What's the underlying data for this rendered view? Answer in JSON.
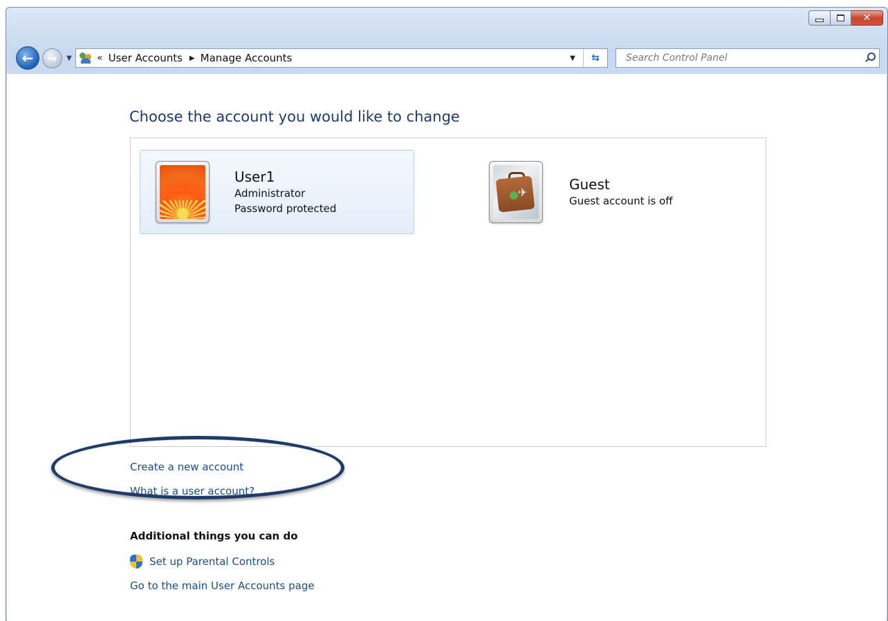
{
  "navigation": {
    "breadcrumb_overflow": "«",
    "breadcrumbs": [
      "User Accounts",
      "Manage Accounts"
    ]
  },
  "search": {
    "placeholder": "Search Control Panel"
  },
  "main": {
    "title": "Choose the account you would like to change",
    "accounts": [
      {
        "name": "User1",
        "lines": [
          "Administrator",
          "Password protected"
        ],
        "picture": "orange-flower",
        "selected": true
      },
      {
        "name": "Guest",
        "lines": [
          "Guest account is off"
        ],
        "picture": "suitcase",
        "selected": false
      }
    ],
    "links": {
      "create_account": "Create a new account",
      "what_is_account": "What is a user account?"
    },
    "additional": {
      "heading": "Additional things you can do",
      "parental_controls": "Set up Parental Controls",
      "main_page": "Go to the main User Accounts page"
    }
  },
  "annotation": {
    "type": "ellipse-highlight",
    "color": "#1f3b69",
    "target": "create_account"
  },
  "icons": [
    "back-arrow-icon",
    "forward-arrow-icon",
    "user-accounts-icon",
    "refresh-icon",
    "search-icon",
    "shield-icon"
  ]
}
